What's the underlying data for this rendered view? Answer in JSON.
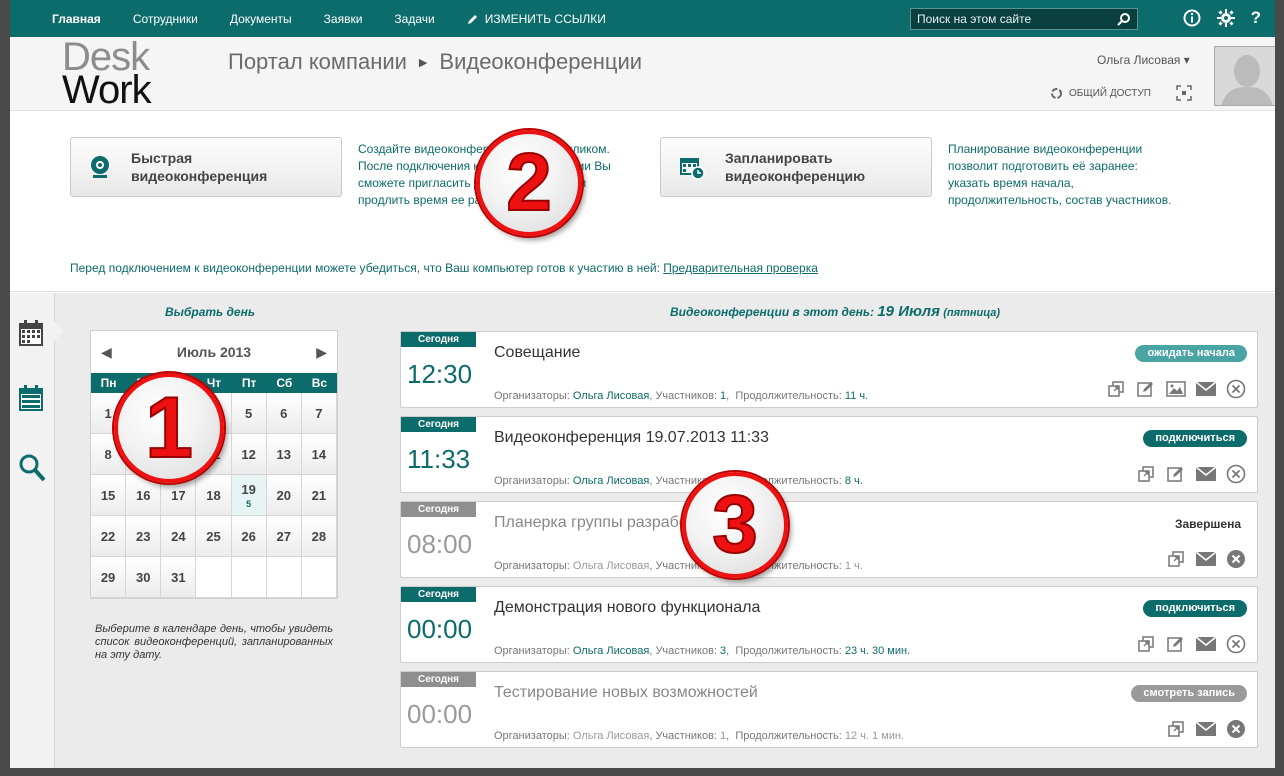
{
  "nav": {
    "items": [
      "Главная",
      "Сотрудники",
      "Документы",
      "Заявки",
      "Задачи"
    ],
    "edit_links": "ИЗМЕНИТЬ ССЫЛКИ",
    "search_placeholder": "Поиск на этом сайте",
    "icons": [
      "info-icon",
      "gear-icon",
      "help-icon"
    ],
    "help_glyph": "?"
  },
  "header": {
    "logo_line1": "Desk",
    "logo_line2": "Work",
    "breadcrumb": [
      "Портал компании",
      "Видеоконференции"
    ],
    "user_name": "Ольга Лисовая ▾",
    "share": "ОБЩИЙ ДОСТУП"
  },
  "actions": {
    "quick": {
      "line1": "Быстрая",
      "line2": "видеоконференция"
    },
    "quick_desc": "Создайте видеоконференцию одним кликом. После подключения к видеоконференции Вы сможете пригласить других участников и продлить время ее работы.",
    "plan": {
      "line1": "Запланировать",
      "line2": "видеоконференцию"
    },
    "plan_desc": "Планирование видеоконференции позволит подготовить её заранее: указать время начала, продолжительность, состав участников.",
    "pre_check_text": "Перед подключением к видеоконференции можете убедиться, что Ваш компьютер готов к участию в ней: ",
    "pre_check_link": "Предварительная проверка"
  },
  "calendar": {
    "title": "Выбрать день",
    "month": "Июль 2013",
    "dow": [
      "Пн",
      "Вт",
      "Ср",
      "Чт",
      "Пт",
      "Сб",
      "Вс"
    ],
    "days": [
      "1",
      "2",
      "3",
      "4",
      "5",
      "6",
      "7",
      "8",
      "9",
      "10",
      "11",
      "12",
      "13",
      "14",
      "15",
      "16",
      "17",
      "18",
      "19",
      "20",
      "21",
      "22",
      "23",
      "24",
      "25",
      "26",
      "27",
      "28",
      "29",
      "30",
      "31",
      "",
      "",
      "",
      ""
    ],
    "selected_day": "19",
    "selected_count": "5",
    "hint": "Выберите в календаре день, чтобы увидеть список видеоконференций, запланированных на эту дату."
  },
  "conf_header": {
    "prefix": "Видеоконференции в этот день:",
    "date": "19 Июля",
    "weekday": "(пятница)"
  },
  "labels": {
    "today": "Сегодня",
    "organizers": "Организаторы: ",
    "participants": "Участников: ",
    "duration": "Продолжительность: "
  },
  "conferences": [
    {
      "time": "12:30",
      "title": "Совещание",
      "organizer": "Ольга Лисовая",
      "participants": "1",
      "duration": "11 ч.",
      "status": "ожидать начала",
      "state": "active"
    },
    {
      "time": "11:33",
      "title": "Видеоконференция 19.07.2013 11:33",
      "organizer": "Ольга Лисовая",
      "participants": "1",
      "duration": "8 ч.",
      "status": "подключиться",
      "state": "active"
    },
    {
      "time": "08:00",
      "title": "Планерка группы разработки",
      "organizer": "Ольга Лисовая",
      "participants": "1",
      "duration": "1 ч.",
      "status": "Завершена",
      "state": "done"
    },
    {
      "time": "00:00",
      "title": "Демонстрация нового функционала",
      "organizer": "Ольга Лисовая",
      "participants": "3",
      "duration": "23 ч. 30 мин.",
      "status": "подключиться",
      "state": "active"
    },
    {
      "time": "00:00",
      "title": "Тестирование новых возможностей",
      "organizer": "Ольга Лисовая",
      "participants": "1",
      "duration": "12 ч. 1 мин.",
      "status": "смотреть запись",
      "state": "done"
    }
  ],
  "badges": [
    "1",
    "2",
    "3"
  ],
  "colors": {
    "accent": "#0c6b6b",
    "badge": "#e11111"
  }
}
